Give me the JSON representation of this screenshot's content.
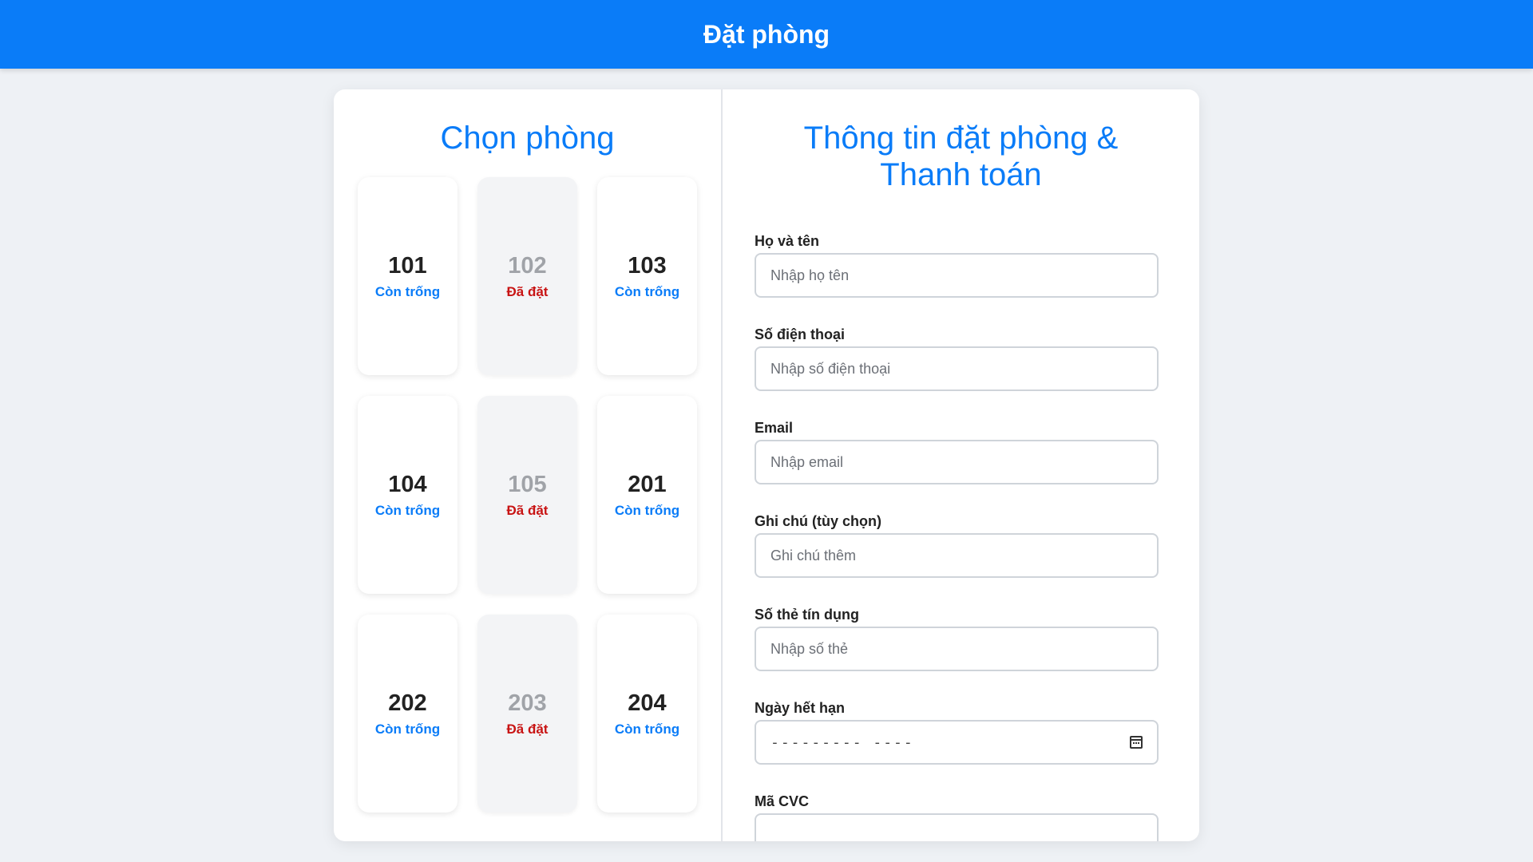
{
  "header": {
    "title": "Đặt phòng"
  },
  "rooms_section": {
    "title": "Chọn phòng",
    "rooms": [
      {
        "number": "101",
        "status": "Còn trống",
        "booked": false
      },
      {
        "number": "102",
        "status": "Đã đặt",
        "booked": true
      },
      {
        "number": "103",
        "status": "Còn trống",
        "booked": false
      },
      {
        "number": "104",
        "status": "Còn trống",
        "booked": false
      },
      {
        "number": "105",
        "status": "Đã đặt",
        "booked": true
      },
      {
        "number": "201",
        "status": "Còn trống",
        "booked": false
      },
      {
        "number": "202",
        "status": "Còn trống",
        "booked": false
      },
      {
        "number": "203",
        "status": "Đã đặt",
        "booked": true
      },
      {
        "number": "204",
        "status": "Còn trống",
        "booked": false
      }
    ]
  },
  "form_section": {
    "title": "Thông tin đặt phòng & Thanh toán",
    "fields": {
      "name": {
        "label": "Họ và tên",
        "placeholder": "Nhập họ tên"
      },
      "phone": {
        "label": "Số điện thoại",
        "placeholder": "Nhập số điện thoại"
      },
      "email": {
        "label": "Email",
        "placeholder": "Nhập email"
      },
      "note": {
        "label": "Ghi chú (tùy chọn)",
        "placeholder": "Ghi chú thêm"
      },
      "card": {
        "label": "Số thẻ tín dụng",
        "placeholder": "Nhập số thẻ"
      },
      "expiry": {
        "label": "Ngày hết hạn",
        "placeholder": "--------- ----",
        "icon": "calendar-icon"
      },
      "cvc": {
        "label": "Mã CVC"
      }
    }
  },
  "colors": {
    "accent": "#0a7cf8",
    "available": "#0a7cf8",
    "booked": "#c81414",
    "background": "#eef1f5"
  }
}
